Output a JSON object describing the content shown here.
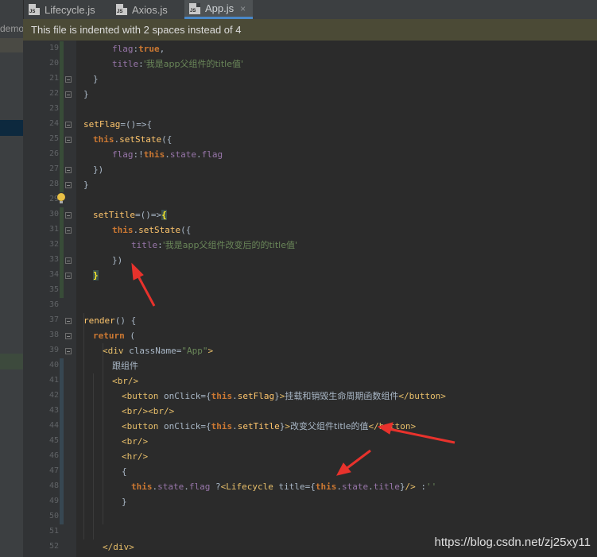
{
  "tabs": [
    {
      "label": "Lifecycle.js",
      "active": false
    },
    {
      "label": "Axios.js",
      "active": false
    },
    {
      "label": "App.js",
      "active": true
    }
  ],
  "tab_close_glyph": "×",
  "file_icon_text": "JS",
  "sidebar": {
    "project_label": "demo"
  },
  "banner": {
    "text": "This file is indented with 2 spaces instead of 4"
  },
  "line_numbers": [
    "19",
    "20",
    "21",
    "22",
    "23",
    "24",
    "25",
    "26",
    "27",
    "28",
    "29",
    "30",
    "31",
    "32",
    "33",
    "34",
    "35",
    "36",
    "37",
    "38",
    "39",
    "40",
    "41",
    "42",
    "43",
    "44",
    "45",
    "46",
    "47",
    "48",
    "49",
    "50",
    "51",
    "52"
  ],
  "code_lines": [
    [
      {
        "t": "flag",
        "c": "prop"
      },
      {
        "t": ":",
        "c": "plain"
      },
      {
        "t": "true",
        "c": "kw"
      },
      {
        "t": ",",
        "c": "plain"
      }
    ],
    [
      {
        "t": "title",
        "c": "prop"
      },
      {
        "t": ":",
        "c": "plain"
      },
      {
        "t": "'我是app父组件的title值'",
        "c": "str"
      }
    ],
    [
      {
        "t": "}",
        "c": "plain"
      }
    ],
    [
      {
        "t": "}",
        "c": "plain"
      }
    ],
    [],
    [
      {
        "t": "setFlag",
        "c": "fn"
      },
      {
        "t": "=()=>{",
        "c": "plain"
      }
    ],
    [
      {
        "t": "this",
        "c": "kw"
      },
      {
        "t": ".",
        "c": "plain"
      },
      {
        "t": "setState",
        "c": "fn"
      },
      {
        "t": "({",
        "c": "plain"
      }
    ],
    [
      {
        "t": "flag",
        "c": "prop"
      },
      {
        "t": ":!",
        "c": "plain"
      },
      {
        "t": "this",
        "c": "kw"
      },
      {
        "t": ".",
        "c": "plain"
      },
      {
        "t": "state",
        "c": "prop"
      },
      {
        "t": ".",
        "c": "plain"
      },
      {
        "t": "flag",
        "c": "prop"
      }
    ],
    [
      {
        "t": "})",
        "c": "plain"
      }
    ],
    [
      {
        "t": "}",
        "c": "plain"
      }
    ],
    [],
    [
      {
        "t": "setTitle",
        "c": "fn"
      },
      {
        "t": "=()=>",
        "c": "plain"
      },
      {
        "t": "{",
        "c": "brace-hl"
      }
    ],
    [
      {
        "t": "this",
        "c": "kw"
      },
      {
        "t": ".",
        "c": "plain"
      },
      {
        "t": "setState",
        "c": "fn"
      },
      {
        "t": "({",
        "c": "plain"
      }
    ],
    [
      {
        "t": "title",
        "c": "prop"
      },
      {
        "t": ":",
        "c": "plain"
      },
      {
        "t": "'我是app父组件改变后的的title值'",
        "c": "str"
      }
    ],
    [
      {
        "t": "})",
        "c": "plain"
      }
    ],
    [
      {
        "t": "}",
        "c": "brace-hl"
      }
    ],
    [],
    [],
    [
      {
        "t": "render",
        "c": "fn"
      },
      {
        "t": "() {",
        "c": "plain"
      }
    ],
    [
      {
        "t": "return",
        "c": "kw"
      },
      {
        "t": " (",
        "c": "plain"
      }
    ],
    [
      {
        "t": "<div ",
        "c": "tag"
      },
      {
        "t": "className",
        "c": "plain"
      },
      {
        "t": "=",
        "c": "plain"
      },
      {
        "t": "\"App\"",
        "c": "str"
      },
      {
        "t": ">",
        "c": "tag"
      }
    ],
    [
      {
        "t": "跟组件",
        "c": "plain"
      }
    ],
    [
      {
        "t": "<br/>",
        "c": "tag"
      }
    ],
    [
      {
        "t": "<button ",
        "c": "tag"
      },
      {
        "t": "onClick",
        "c": "plain"
      },
      {
        "t": "={",
        "c": "plain"
      },
      {
        "t": "this",
        "c": "kw"
      },
      {
        "t": ".",
        "c": "plain"
      },
      {
        "t": "setFlag",
        "c": "fn"
      },
      {
        "t": "}",
        "c": "plain"
      },
      {
        "t": ">",
        "c": "tag"
      },
      {
        "t": "挂载和销毁生命周期函数组件",
        "c": "plain"
      },
      {
        "t": "</button>",
        "c": "tag"
      }
    ],
    [
      {
        "t": "<br/><br/>",
        "c": "tag"
      }
    ],
    [
      {
        "t": "<button ",
        "c": "tag"
      },
      {
        "t": "onClick",
        "c": "plain"
      },
      {
        "t": "={",
        "c": "plain"
      },
      {
        "t": "this",
        "c": "kw"
      },
      {
        "t": ".",
        "c": "plain"
      },
      {
        "t": "setTitle",
        "c": "fn"
      },
      {
        "t": "}",
        "c": "plain"
      },
      {
        "t": ">",
        "c": "tag"
      },
      {
        "t": "改变父组件title的值",
        "c": "plain"
      },
      {
        "t": "</button>",
        "c": "tag"
      }
    ],
    [
      {
        "t": "<br/>",
        "c": "tag"
      }
    ],
    [
      {
        "t": "<hr/>",
        "c": "tag"
      }
    ],
    [
      {
        "t": "{",
        "c": "plain"
      }
    ],
    [
      {
        "t": "this",
        "c": "kw"
      },
      {
        "t": ".",
        "c": "plain"
      },
      {
        "t": "state",
        "c": "prop"
      },
      {
        "t": ".",
        "c": "plain"
      },
      {
        "t": "flag",
        "c": "prop"
      },
      {
        "t": " ?",
        "c": "plain"
      },
      {
        "t": "<Lifecycle ",
        "c": "tag"
      },
      {
        "t": "title",
        "c": "plain"
      },
      {
        "t": "={",
        "c": "plain"
      },
      {
        "t": "this",
        "c": "kw"
      },
      {
        "t": ".",
        "c": "plain"
      },
      {
        "t": "state",
        "c": "prop"
      },
      {
        "t": ".",
        "c": "plain"
      },
      {
        "t": "title",
        "c": "prop"
      },
      {
        "t": "}",
        "c": "plain"
      },
      {
        "t": "/>",
        "c": "tag"
      },
      {
        "t": " :",
        "c": "plain"
      },
      {
        "t": "''",
        "c": "str"
      }
    ],
    [
      {
        "t": "}",
        "c": "plain"
      }
    ],
    [],
    [],
    [
      {
        "t": "</div>",
        "c": "tag"
      }
    ]
  ],
  "watermark": "https://blog.csdn.net/zj25xy11",
  "colors": {
    "editor_bg": "#2b2b2b",
    "gutter_bg": "#313335",
    "banner_bg": "#4b4a36",
    "keyword": "#cc7832",
    "function": "#ffc66d",
    "property": "#9876aa",
    "string": "#6a8759",
    "tag": "#e8bf6a",
    "vcs_added": "#384c38",
    "vcs_modified": "#374752",
    "arrow": "#e8322c"
  }
}
